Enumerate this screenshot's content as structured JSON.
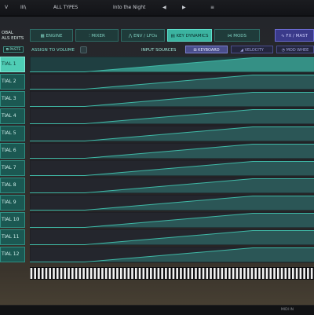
{
  "topbar": {
    "left_glyph": "V",
    "library_icon": "III\\",
    "type_filter": "ALL TYPES",
    "preset_name": "Into the Night",
    "prev": "◀",
    "next": "▶",
    "menu": "≡"
  },
  "tabs": [
    {
      "label": "ENGINE",
      "icon": "grid-icon",
      "active": false
    },
    {
      "label": "MIXER",
      "icon": "mixer-icon",
      "active": false
    },
    {
      "label": "ENV / LFOs",
      "icon": "envelope-icon",
      "active": false
    },
    {
      "label": "KEY DYNAMICS",
      "icon": "keyboard-icon",
      "active": true
    },
    {
      "label": "MODS",
      "icon": "mods-icon",
      "active": false
    },
    {
      "label": "FX / MAST",
      "icon": "fx-icon",
      "active": false
    }
  ],
  "global": {
    "line1": "OBAL",
    "line2": "ALS EDITS"
  },
  "paste_label": "PASTE",
  "assign_label": "ASSIGN TO VOLUME",
  "input_sources": {
    "label": "INPUT SOURCES",
    "items": [
      {
        "label": "KEYBOARD",
        "active": true
      },
      {
        "label": "VELOCITY",
        "active": false
      },
      {
        "label": "MOD WHEE",
        "active": false
      }
    ]
  },
  "partials": [
    {
      "label": "TIAL 1",
      "active": true
    },
    {
      "label": "TIAL 2",
      "active": false
    },
    {
      "label": "TIAL 3",
      "active": false
    },
    {
      "label": "TIAL 4",
      "active": false
    },
    {
      "label": "TIAL 5",
      "active": false
    },
    {
      "label": "TIAL 6",
      "active": false
    },
    {
      "label": "TIAL 7",
      "active": false
    },
    {
      "label": "TIAL 8",
      "active": false
    },
    {
      "label": "TIAL 9",
      "active": false
    },
    {
      "label": "TIAL 10",
      "active": false
    },
    {
      "label": "TIAL 11",
      "active": false
    },
    {
      "label": "TIAL 12",
      "active": false
    }
  ],
  "status": {
    "right": "MIDI IN"
  },
  "colors": {
    "accent": "#4fcdb5",
    "fx": "#3a3a8a",
    "curve": "#3fb8a6"
  }
}
